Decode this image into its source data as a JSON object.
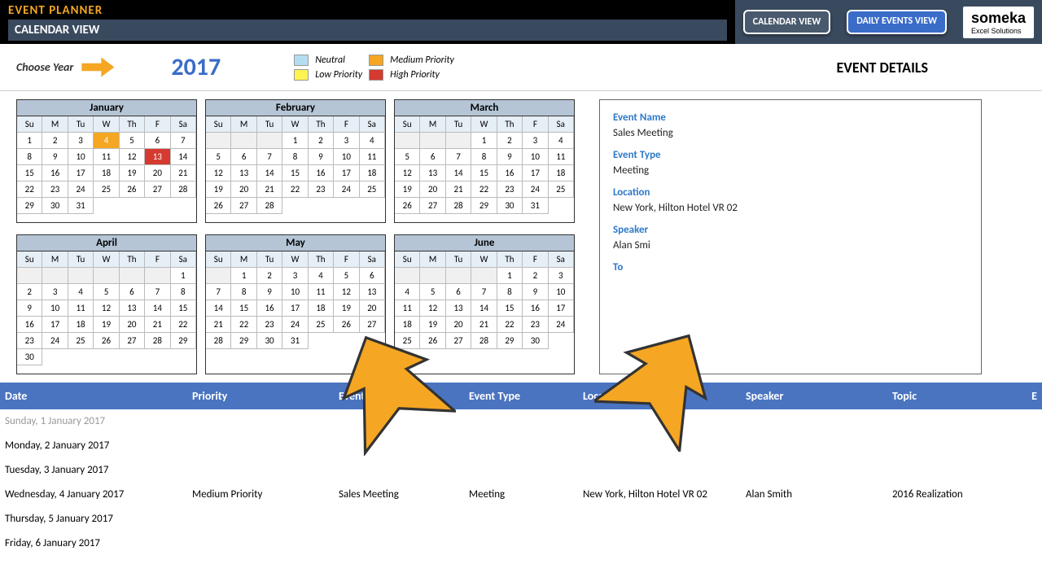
{
  "header": {
    "title1": "EVENT PLANNER",
    "title2": "CALENDAR VIEW",
    "btn_cal": "CALENDAR VIEW",
    "btn_daily": "DAILY EVENTS VIEW",
    "logo": "someka",
    "logo_sub": "Excel Solutions"
  },
  "toolbar": {
    "choose_year": "Choose Year",
    "year": "2017",
    "legend": {
      "neutral": "Neutral",
      "low": "Low Priority",
      "med": "Medium Priority",
      "high": "High Priority"
    },
    "details_title": "EVENT DETAILS"
  },
  "dow": [
    "Su",
    "M",
    "Tu",
    "W",
    "Th",
    "F",
    "Sa"
  ],
  "months": [
    {
      "name": "January",
      "start": 0,
      "days": 31,
      "med": [
        4
      ],
      "high": [
        13
      ]
    },
    {
      "name": "February",
      "start": 3,
      "days": 28
    },
    {
      "name": "March",
      "start": 3,
      "days": 31
    },
    {
      "name": "April",
      "start": 6,
      "days": 30
    },
    {
      "name": "May",
      "start": 1,
      "days": 31
    },
    {
      "name": "June",
      "start": 4,
      "days": 30
    }
  ],
  "details": {
    "l_name": "Event Name",
    "v_name": "Sales Meeting",
    "l_type": "Event Type",
    "v_type": "Meeting",
    "l_loc": "Location",
    "v_loc": "New York, Hilton Hotel VR 02",
    "l_spk": "Speaker",
    "v_spk": "Alan Smi",
    "l_topic": "To"
  },
  "table": {
    "h_date": "Date",
    "h_pri": "Priority",
    "h_name": "Event Name",
    "h_type": "Event Type",
    "h_loc": "Location",
    "h_spk": "Speaker",
    "h_topic": "Topic",
    "h_last": "E",
    "rows": [
      {
        "date": "Sunday, 1 January 2017",
        "faded": true
      },
      {
        "date": "Monday, 2 January 2017"
      },
      {
        "date": "Tuesday, 3 January 2017"
      },
      {
        "date": "Wednesday, 4 January 2017",
        "pri": "Medium Priority",
        "name": "Sales Meeting",
        "type": "Meeting",
        "loc": "New York, Hilton Hotel VR 02",
        "spk": "Alan Smith",
        "topic": "2016 Realization"
      },
      {
        "date": "Thursday, 5 January 2017"
      },
      {
        "date": "Friday, 6 January 2017"
      }
    ]
  }
}
